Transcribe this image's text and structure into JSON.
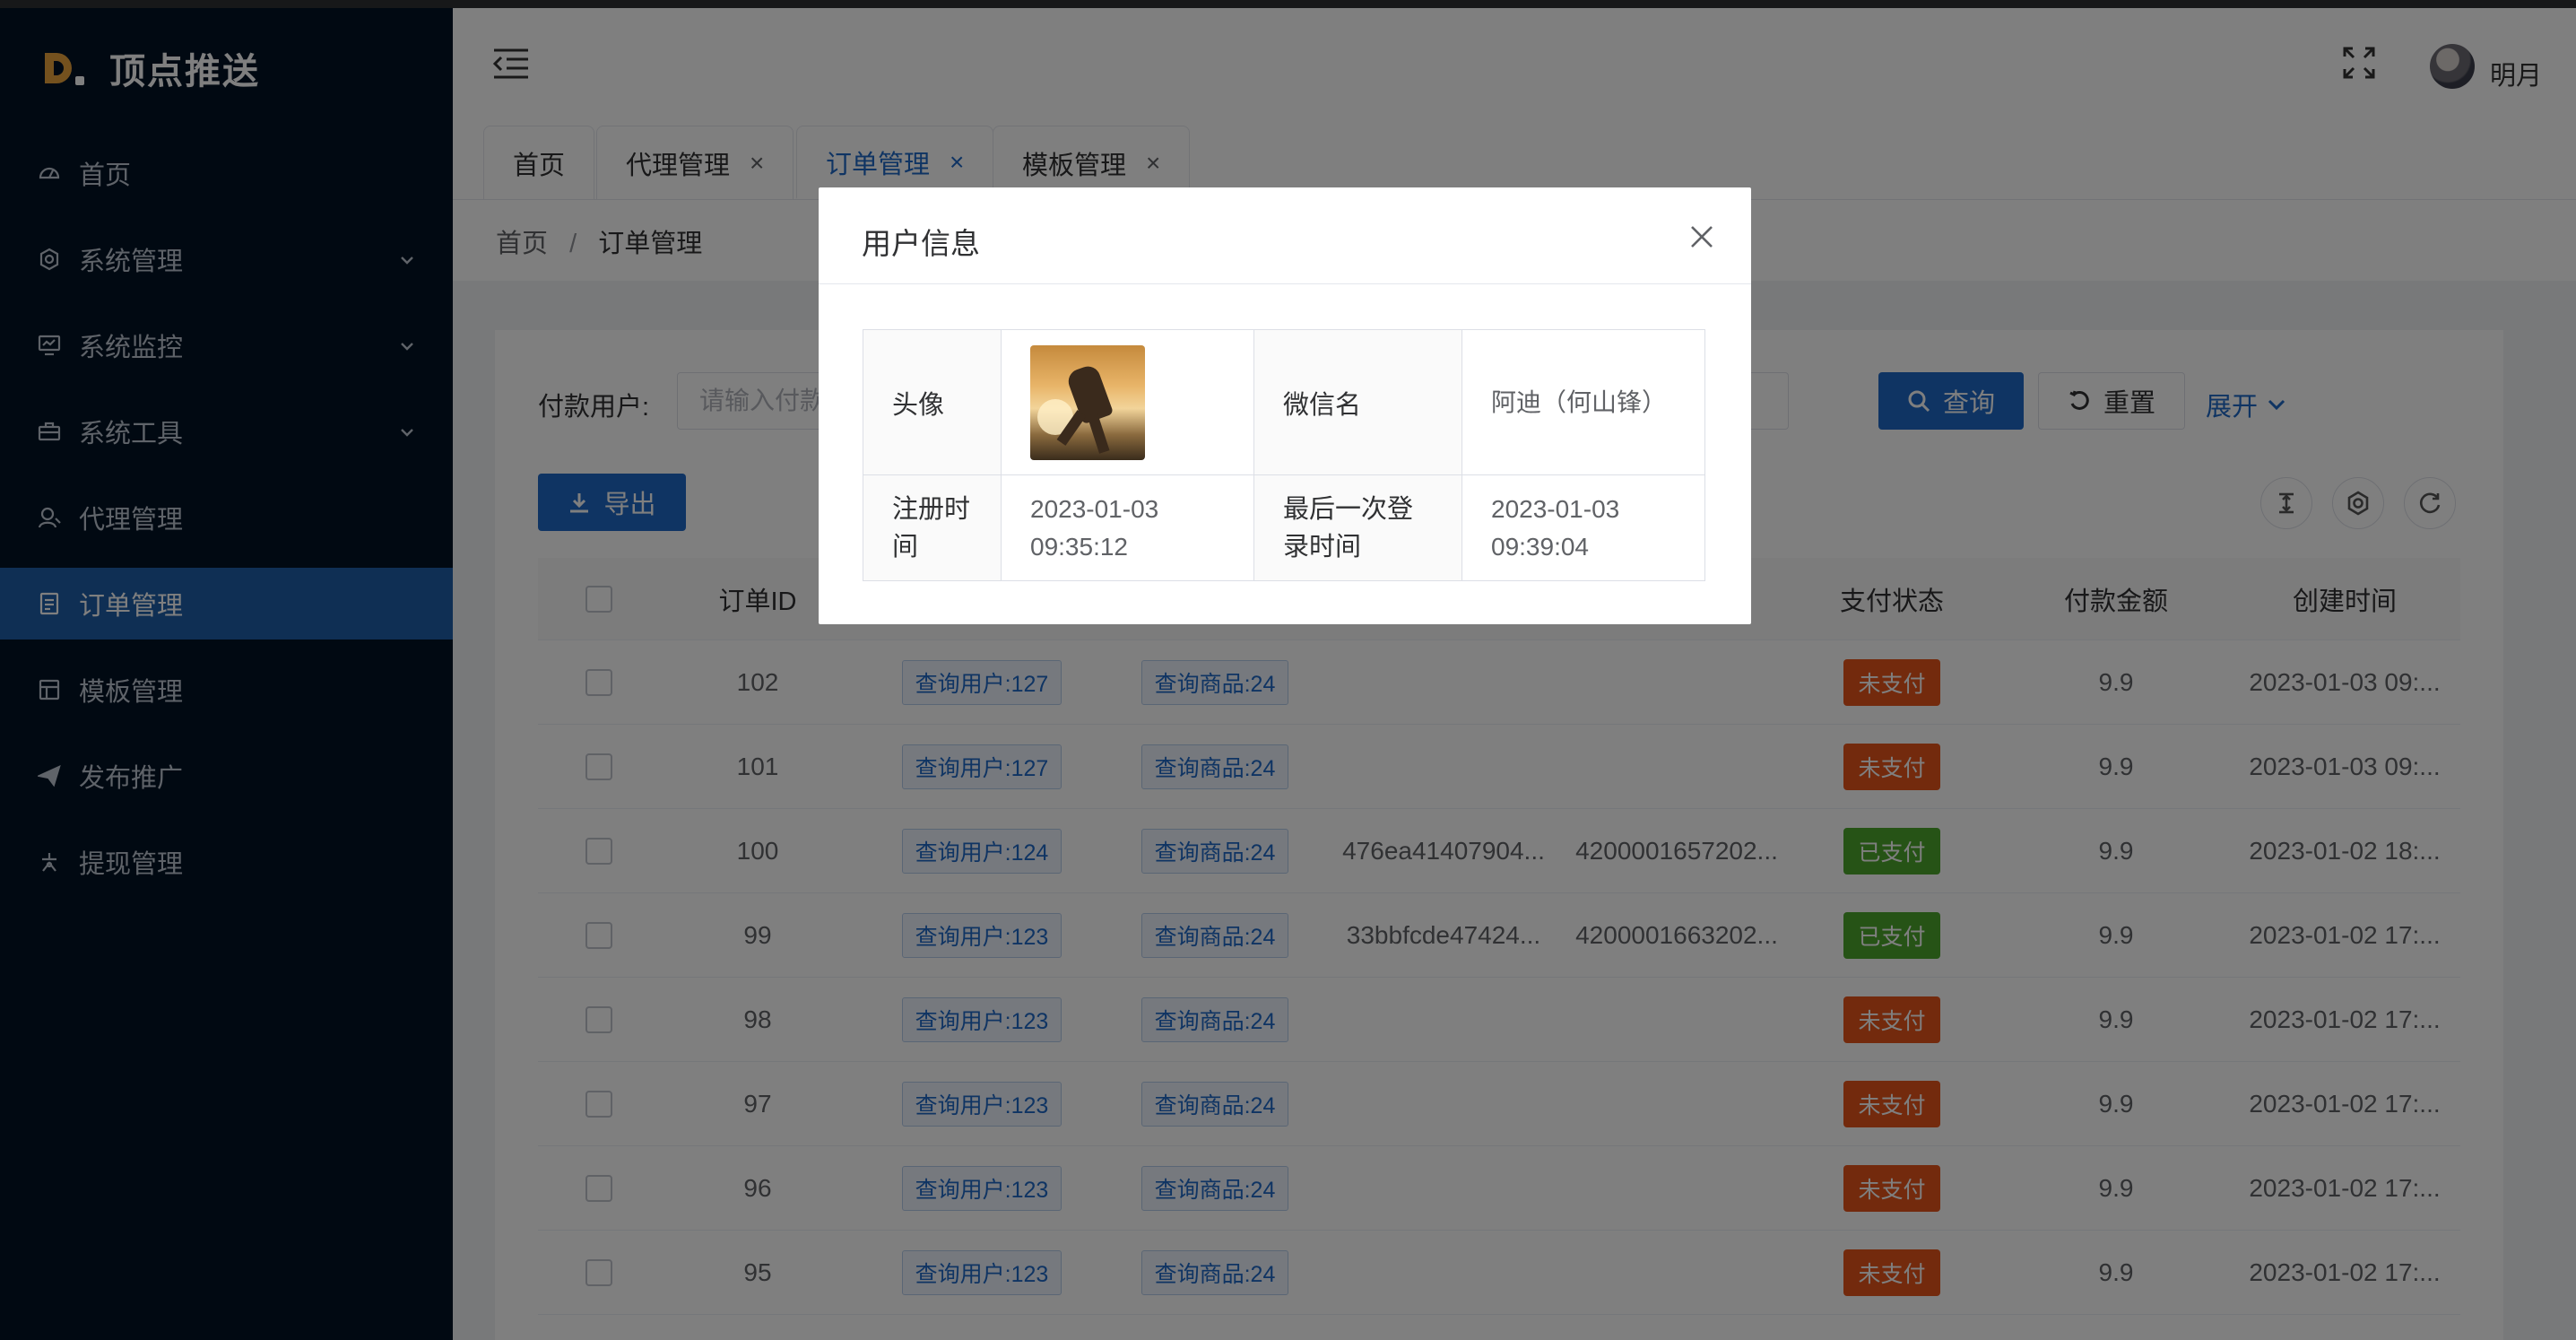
{
  "app": {
    "logo_text": "顶点推送",
    "username": "明月"
  },
  "sidebar": {
    "items": [
      {
        "label": "首页",
        "icon": "dashboard-icon",
        "has_arrow": false,
        "active": false
      },
      {
        "label": "系统管理",
        "icon": "gear-icon",
        "has_arrow": true,
        "active": false
      },
      {
        "label": "系统监控",
        "icon": "monitor-icon",
        "has_arrow": true,
        "active": false
      },
      {
        "label": "系统工具",
        "icon": "toolbox-icon",
        "has_arrow": true,
        "active": false
      },
      {
        "label": "代理管理",
        "icon": "user-icon",
        "has_arrow": false,
        "active": false
      },
      {
        "label": "订单管理",
        "icon": "document-icon",
        "has_arrow": false,
        "active": true
      },
      {
        "label": "模板管理",
        "icon": "template-icon",
        "has_arrow": false,
        "active": false
      },
      {
        "label": "发布推广",
        "icon": "send-icon",
        "has_arrow": false,
        "active": false
      },
      {
        "label": "提现管理",
        "icon": "withdraw-icon",
        "has_arrow": false,
        "active": false
      }
    ]
  },
  "tabs": [
    {
      "label": "首页",
      "closable": false,
      "active": false
    },
    {
      "label": "代理管理",
      "closable": true,
      "active": false
    },
    {
      "label": "订单管理",
      "closable": true,
      "active": true
    },
    {
      "label": "模板管理",
      "closable": true,
      "active": false
    }
  ],
  "tab_close_glyph": "×",
  "breadcrumb": {
    "home": "首页",
    "separator": "/",
    "current": "订单管理"
  },
  "search": {
    "label": "付款用户:",
    "placeholder": "请输入付款用户",
    "query_button": "查询",
    "reset_button": "重置",
    "expand_link": "展开"
  },
  "toolbar": {
    "export_button": "导出"
  },
  "table": {
    "headers": {
      "order_id": "订单ID",
      "pay_status": "支付状态",
      "amount": "付款金额",
      "created": "创建时间"
    },
    "rows": [
      {
        "id": "102",
        "user": "查询用户:127",
        "product": "查询商品:24",
        "order_no": "",
        "txn_no": "",
        "status": "未支付",
        "paid": false,
        "amount": "9.9",
        "created": "2023-01-03 09:..."
      },
      {
        "id": "101",
        "user": "查询用户:127",
        "product": "查询商品:24",
        "order_no": "",
        "txn_no": "",
        "status": "未支付",
        "paid": false,
        "amount": "9.9",
        "created": "2023-01-03 09:..."
      },
      {
        "id": "100",
        "user": "查询用户:124",
        "product": "查询商品:24",
        "order_no": "476ea41407904...",
        "txn_no": "4200001657202...",
        "status": "已支付",
        "paid": true,
        "amount": "9.9",
        "created": "2023-01-02 18:..."
      },
      {
        "id": "99",
        "user": "查询用户:123",
        "product": "查询商品:24",
        "order_no": "33bbfcde47424...",
        "txn_no": "4200001663202...",
        "status": "已支付",
        "paid": true,
        "amount": "9.9",
        "created": "2023-01-02 17:..."
      },
      {
        "id": "98",
        "user": "查询用户:123",
        "product": "查询商品:24",
        "order_no": "",
        "txn_no": "",
        "status": "未支付",
        "paid": false,
        "amount": "9.9",
        "created": "2023-01-02 17:..."
      },
      {
        "id": "97",
        "user": "查询用户:123",
        "product": "查询商品:24",
        "order_no": "",
        "txn_no": "",
        "status": "未支付",
        "paid": false,
        "amount": "9.9",
        "created": "2023-01-02 17:..."
      },
      {
        "id": "96",
        "user": "查询用户:123",
        "product": "查询商品:24",
        "order_no": "",
        "txn_no": "",
        "status": "未支付",
        "paid": false,
        "amount": "9.9",
        "created": "2023-01-02 17:..."
      },
      {
        "id": "95",
        "user": "查询用户:123",
        "product": "查询商品:24",
        "order_no": "",
        "txn_no": "",
        "status": "未支付",
        "paid": false,
        "amount": "9.9",
        "created": "2023-01-02 17:..."
      }
    ]
  },
  "dialog": {
    "title": "用户信息",
    "avatar_label": "头像",
    "wechat_label": "微信名",
    "wechat_value": "阿迪（何山锋）",
    "register_label": "注册时间",
    "register_value": "2023-01-03 09:35:12",
    "last_login_label": "最后一次登录时间",
    "last_login_value": "2023-01-03 09:39:04"
  },
  "colors": {
    "sidebar_bg": "#031325",
    "accent": "#1f68c6",
    "active_menu": "#1f5ea8",
    "unpaid": "#e6541a",
    "paid": "#4ca62c"
  }
}
